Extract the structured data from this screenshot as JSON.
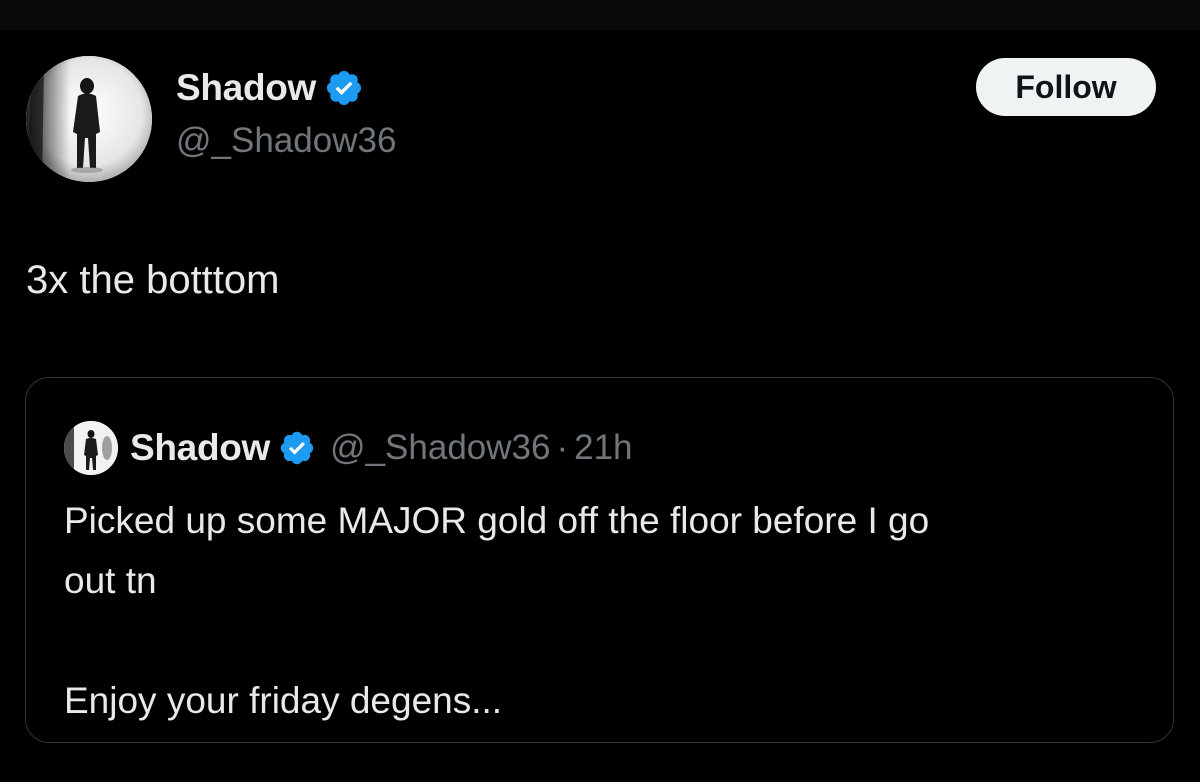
{
  "author": {
    "name": "Shadow",
    "handle": "@_Shadow36",
    "verified": true
  },
  "follow_button": {
    "label": "Follow"
  },
  "tweet": {
    "text": "3x the botttom"
  },
  "quoted_tweet": {
    "name": "Shadow",
    "handle": "@_Shadow36",
    "separator": "·",
    "time": "21h",
    "body_lines": [
      "Picked up some MAJOR gold off the floor before I go",
      "out tn",
      "Enjoy your friday degens..."
    ]
  },
  "colors": {
    "background": "#000000",
    "text_primary": "#e7e9ea",
    "text_secondary": "#71767b",
    "verified_blue": "#1d9bf0",
    "follow_bg": "#eff3f4",
    "border": "#2f3336"
  },
  "icons": {
    "verified": "verified-badge-icon",
    "avatar": "silhouette-avatar"
  }
}
